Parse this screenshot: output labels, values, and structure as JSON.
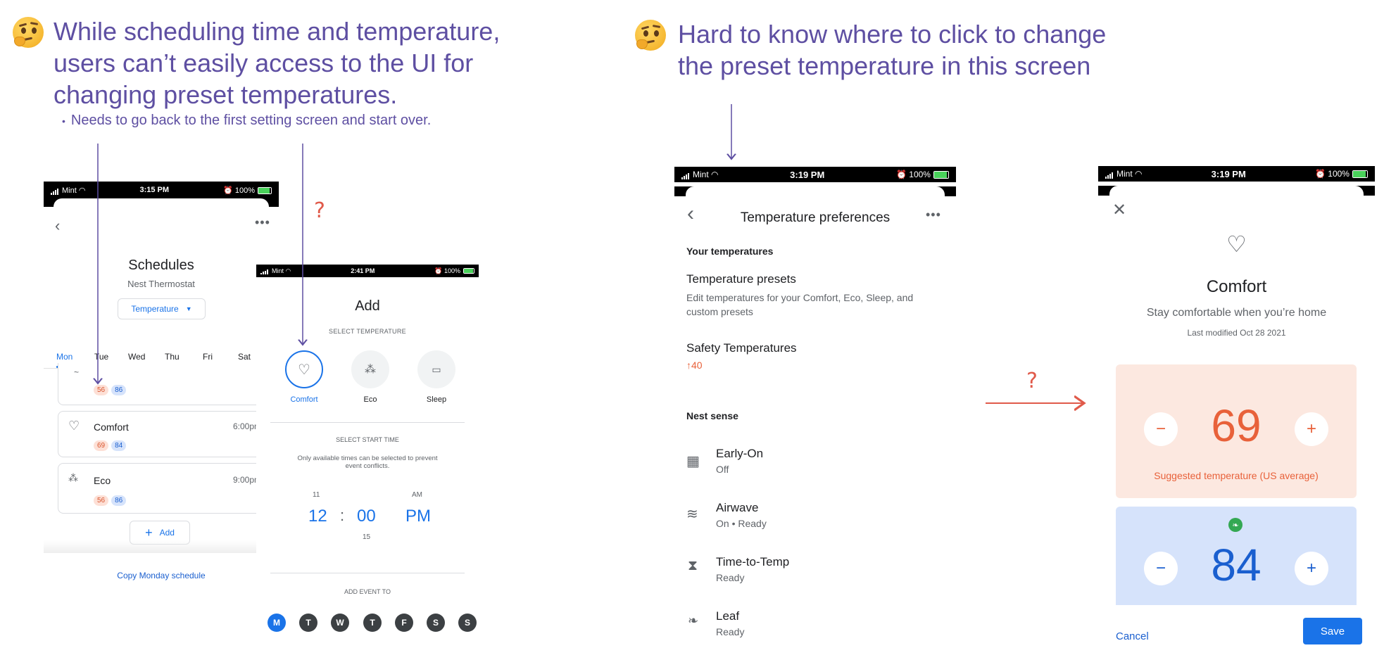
{
  "annotations": {
    "left_heading": [
      "While scheduling time and temperature,",
      "users can’t easily access to the UI for",
      "changing preset temperatures."
    ],
    "left_bullet": "Needs to go back to the first setting screen and start over.",
    "right_heading": [
      "Hard to know where to click to change",
      "the preset temperature in this screen"
    ],
    "question_mark": "?"
  },
  "screen1": {
    "status": {
      "carrier": "Mint",
      "time": "3:15 PM",
      "battery": "100%"
    },
    "title": "Schedules",
    "subtitle": "Nest Thermostat",
    "dropdown": "Temperature",
    "days": [
      "Mon",
      "Tue",
      "Wed",
      "Thu",
      "Fri",
      "Sat"
    ],
    "events": [
      {
        "name": "",
        "time": "",
        "heat": "56",
        "cool": "86"
      },
      {
        "name": "Comfort",
        "time": "6:00pm",
        "heat": "69",
        "cool": "84"
      },
      {
        "name": "Eco",
        "time": "9:00pm",
        "heat": "56",
        "cool": "86"
      }
    ],
    "add_label": "Add",
    "copy_label": "Copy Monday schedule"
  },
  "screen2": {
    "status": {
      "carrier": "Mint",
      "time": "2:41 PM",
      "battery": "100%"
    },
    "title": "Add",
    "select_temp": "SELECT TEMPERATURE",
    "presets": [
      "Comfort",
      "Eco",
      "Sleep"
    ],
    "select_start": "SELECT START TIME",
    "note": [
      "Only available times can be selected to prevent",
      "event conflicts."
    ],
    "time_above": {
      "h": "11",
      "ampm": "AM"
    },
    "time": {
      "h": "12",
      "sep": ":",
      "m": "00",
      "ampm": "PM"
    },
    "time_below": {
      "m": "15"
    },
    "add_event_to": "ADD EVENT TO",
    "weekdays": [
      "M",
      "T",
      "W",
      "T",
      "F",
      "S",
      "S"
    ]
  },
  "screen3": {
    "status": {
      "carrier": "Mint",
      "time": "3:19 PM",
      "battery": "100%"
    },
    "title": "Temperature preferences",
    "your_temps": "Your temperatures",
    "presets_title": "Temperature presets",
    "presets_desc": [
      "Edit temperatures for your Comfort, Eco, Sleep, and",
      "custom presets"
    ],
    "safety_title": "Safety Temperatures",
    "safety_value": "↑40",
    "nest_sense": "Nest sense",
    "items": [
      {
        "title": "Early-On",
        "sub": "Off",
        "icon": "calendar-sun-icon"
      },
      {
        "title": "Airwave",
        "sub": "On • Ready",
        "icon": "waves-icon"
      },
      {
        "title": "Time-to-Temp",
        "sub": "Ready",
        "icon": "hourglass-icon"
      },
      {
        "title": "Leaf",
        "sub": "Ready",
        "icon": "leaf-icon"
      }
    ]
  },
  "screen4": {
    "status": {
      "carrier": "Mint",
      "time": "3:19 PM",
      "battery": "100%"
    },
    "title": "Comfort",
    "subtitle": "Stay comfortable when you’re home",
    "modified": "Last modified Oct 28 2021",
    "heat_value": "69",
    "heat_note": "Suggested temperature (US average)",
    "cool_value": "84",
    "cancel": "Cancel",
    "save": "Save"
  },
  "colors": {
    "accent": "#1a73e8",
    "heat": "#e8613a",
    "annotation": "#5e4fa2",
    "question": "#e05a4a"
  }
}
